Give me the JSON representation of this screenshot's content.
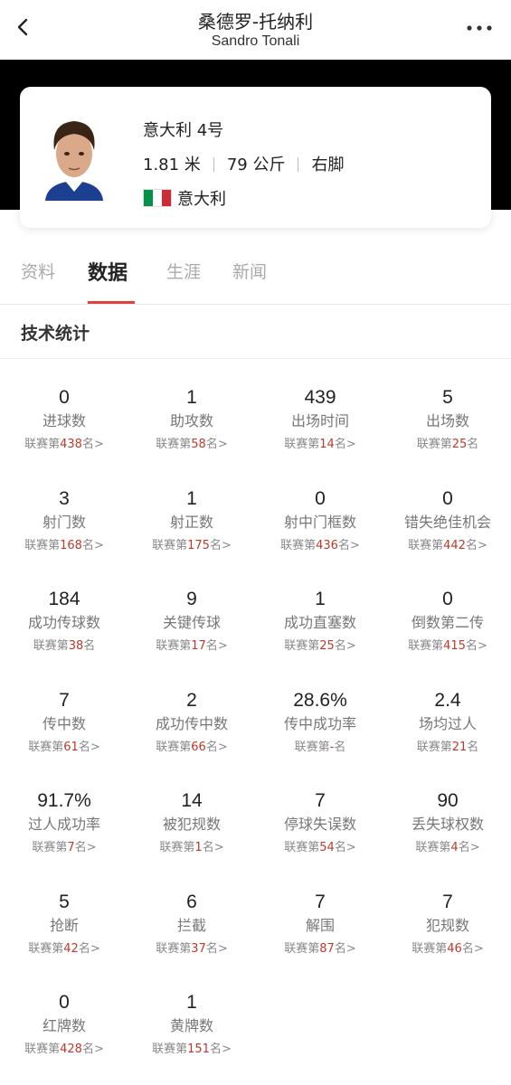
{
  "header": {
    "title_zh": "桑德罗-托纳利",
    "title_en": "Sandro Tonali"
  },
  "player": {
    "team_number": "意大利 4号",
    "height": "1.81 米",
    "weight": "79 公斤",
    "foot": "右脚",
    "nationality": "意大利",
    "flag_colors": [
      "#009246",
      "#ffffff",
      "#ce2b37"
    ]
  },
  "tabs": [
    {
      "label": "资料",
      "active": false
    },
    {
      "label": "数据",
      "active": true
    },
    {
      "label": "生涯",
      "active": false
    },
    {
      "label": "新闻",
      "active": false
    }
  ],
  "section": {
    "title": "技术统计"
  },
  "accent_color": "#e0413a",
  "stats": [
    {
      "value": "0",
      "label": "进球数",
      "rank_prefix": "联赛第",
      "rank": "438",
      "rank_suffix": "名>"
    },
    {
      "value": "1",
      "label": "助攻数",
      "rank_prefix": "联赛第",
      "rank": "58",
      "rank_suffix": "名>"
    },
    {
      "value": "439",
      "label": "出场时间",
      "rank_prefix": "联赛第",
      "rank": "14",
      "rank_suffix": "名>"
    },
    {
      "value": "5",
      "label": "出场数",
      "rank_prefix": "联赛第",
      "rank": "25",
      "rank_suffix": "名"
    },
    {
      "value": "3",
      "label": "射门数",
      "rank_prefix": "联赛第",
      "rank": "168",
      "rank_suffix": "名>"
    },
    {
      "value": "1",
      "label": "射正数",
      "rank_prefix": "联赛第",
      "rank": "175",
      "rank_suffix": "名>"
    },
    {
      "value": "0",
      "label": "射中门框数",
      "rank_prefix": "联赛第",
      "rank": "436",
      "rank_suffix": "名>"
    },
    {
      "value": "0",
      "label": "错失绝佳机会",
      "rank_prefix": "联赛第",
      "rank": "442",
      "rank_suffix": "名>"
    },
    {
      "value": "184",
      "label": "成功传球数",
      "rank_prefix": "联赛第",
      "rank": "38",
      "rank_suffix": "名"
    },
    {
      "value": "9",
      "label": "关键传球",
      "rank_prefix": "联赛第",
      "rank": "17",
      "rank_suffix": "名>"
    },
    {
      "value": "1",
      "label": "成功直塞数",
      "rank_prefix": "联赛第",
      "rank": "25",
      "rank_suffix": "名>"
    },
    {
      "value": "0",
      "label": "倒数第二传",
      "rank_prefix": "联赛第",
      "rank": "415",
      "rank_suffix": "名>"
    },
    {
      "value": "7",
      "label": "传中数",
      "rank_prefix": "联赛第",
      "rank": "61",
      "rank_suffix": "名>"
    },
    {
      "value": "2",
      "label": "成功传中数",
      "rank_prefix": "联赛第",
      "rank": "66",
      "rank_suffix": "名>"
    },
    {
      "value": "28.6%",
      "label": "传中成功率",
      "rank_prefix": "联赛第",
      "rank": "-",
      "rank_suffix": "名"
    },
    {
      "value": "2.4",
      "label": "场均过人",
      "rank_prefix": "联赛第",
      "rank": "21",
      "rank_suffix": "名"
    },
    {
      "value": "91.7%",
      "label": "过人成功率",
      "rank_prefix": "联赛第",
      "rank": "7",
      "rank_suffix": "名>"
    },
    {
      "value": "14",
      "label": "被犯规数",
      "rank_prefix": "联赛第",
      "rank": "1",
      "rank_suffix": "名>"
    },
    {
      "value": "7",
      "label": "停球失误数",
      "rank_prefix": "联赛第",
      "rank": "54",
      "rank_suffix": "名>"
    },
    {
      "value": "90",
      "label": "丢失球权数",
      "rank_prefix": "联赛第",
      "rank": "4",
      "rank_suffix": "名>"
    },
    {
      "value": "5",
      "label": "抢断",
      "rank_prefix": "联赛第",
      "rank": "42",
      "rank_suffix": "名>"
    },
    {
      "value": "6",
      "label": "拦截",
      "rank_prefix": "联赛第",
      "rank": "37",
      "rank_suffix": "名>"
    },
    {
      "value": "7",
      "label": "解围",
      "rank_prefix": "联赛第",
      "rank": "87",
      "rank_suffix": "名>"
    },
    {
      "value": "7",
      "label": "犯规数",
      "rank_prefix": "联赛第",
      "rank": "46",
      "rank_suffix": "名>"
    },
    {
      "value": "0",
      "label": "红牌数",
      "rank_prefix": "联赛第",
      "rank": "428",
      "rank_suffix": "名>"
    },
    {
      "value": "1",
      "label": "黄牌数",
      "rank_prefix": "联赛第",
      "rank": "151",
      "rank_suffix": "名>"
    }
  ],
  "icons": {
    "back": "chevron-left-icon",
    "more": "more-dots-icon"
  }
}
